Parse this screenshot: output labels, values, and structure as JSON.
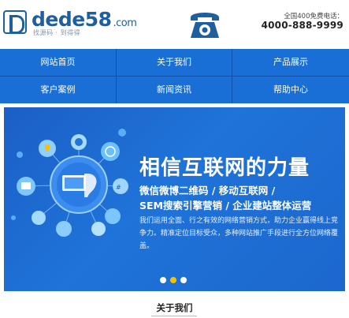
{
  "header": {
    "logo": {
      "main": "dede",
      "num": "58",
      "suffix": ".com",
      "tagline": "找源码 · 到得得"
    },
    "hotline_label": "全国400免费电话：",
    "hotline_number": "4000-888-9999",
    "phone_icon": "telephone-icon"
  },
  "nav": {
    "items": [
      {
        "label": "网站首页"
      },
      {
        "label": "关于我们"
      },
      {
        "label": "产品展示"
      },
      {
        "label": "客户案例"
      },
      {
        "label": "新闻资讯"
      },
      {
        "label": "帮助中心"
      }
    ]
  },
  "banner": {
    "headline": "相信互联网的力量",
    "subline1": "微信微博二维码 / 移动互联网 /",
    "subline2": "SEM搜索引擎营销 / 企业建站整体运营",
    "description": "我们运用全面、行之有效的网络营销方式，助力企业赢得线上竞争力。精准定位目标受众，多种网站推广手段进行全方位网络覆盖。",
    "slides": 3,
    "active_slide": 2
  },
  "section": {
    "title": "关于我们"
  },
  "colors": {
    "brand": "#1f5fa0",
    "nav_bg": "#1a6fd6",
    "banner_bg": "#1f73d9",
    "active_dot": "#f2c200"
  }
}
